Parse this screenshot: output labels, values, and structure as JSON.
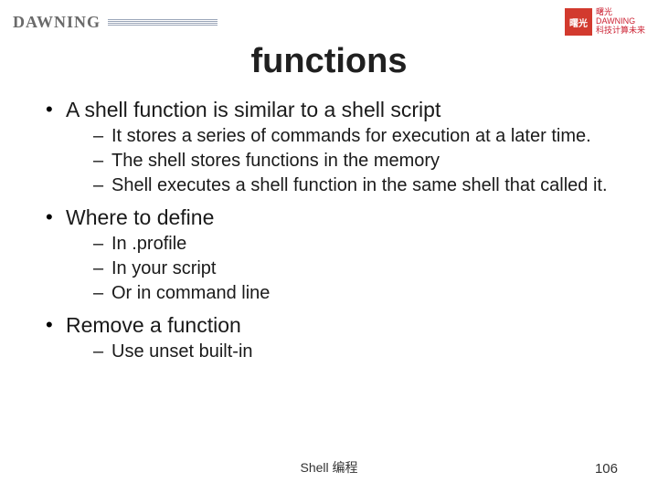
{
  "brand": {
    "left": "DAWNING",
    "right_logo_text": "曙光",
    "right_small1": "曙光",
    "right_small2": "DAWNING",
    "right_tagline": "科技计算未来"
  },
  "title": "functions",
  "bullets": [
    {
      "text": "A shell function is similar to a shell script",
      "sub": [
        "It stores a series of commands for execution at a later time.",
        "The shell stores functions in the memory",
        "Shell executes a shell function in the same shell that called it."
      ]
    },
    {
      "text": "Where to define",
      "sub": [
        "In .profile",
        "In your script",
        "Or in command line"
      ]
    },
    {
      "text": "Remove a function",
      "sub": [
        "Use unset built-in"
      ]
    }
  ],
  "footer": "Shell 编程",
  "page_number": "106"
}
